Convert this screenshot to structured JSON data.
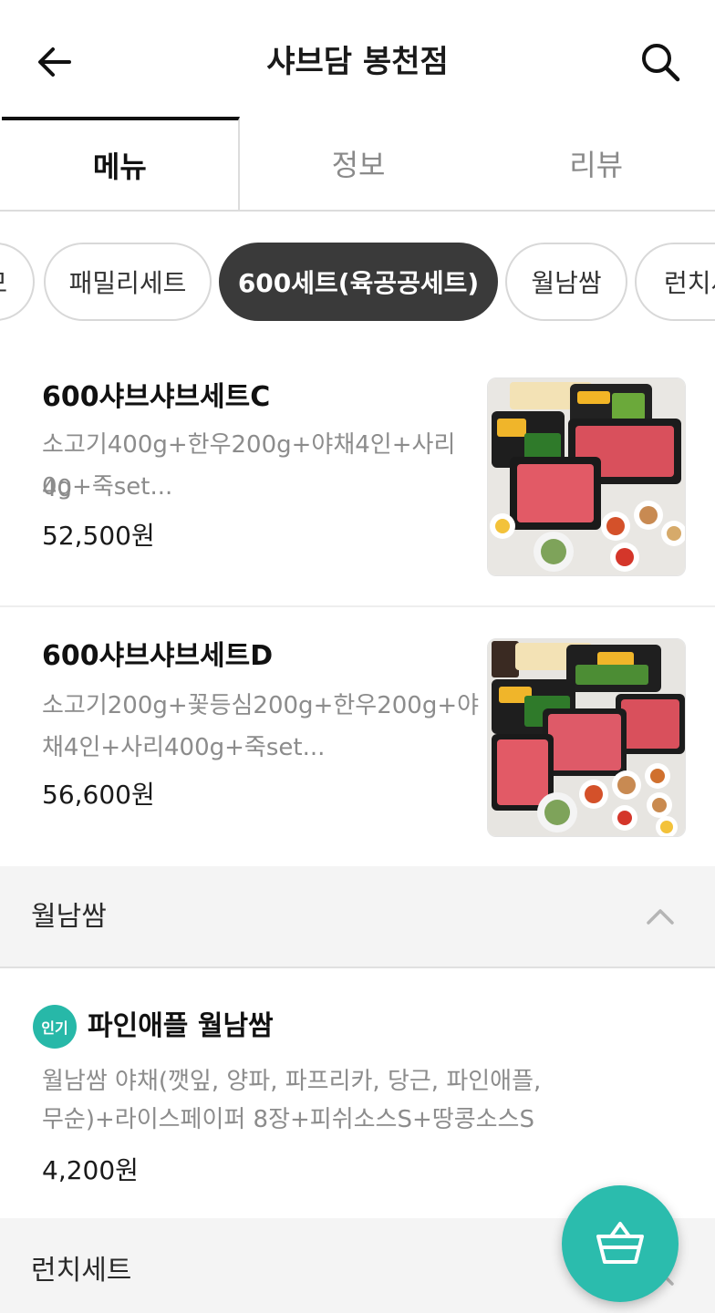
{
  "header": {
    "title": "샤브담 봉천점"
  },
  "tabs": [
    {
      "label": "메뉴"
    },
    {
      "label": "정보"
    },
    {
      "label": "리뷰"
    }
  ],
  "categories": [
    {
      "label": "모"
    },
    {
      "label": "패밀리세트"
    },
    {
      "label": "600세트(육공공세트)"
    },
    {
      "label": "월남쌈"
    },
    {
      "label": "런치세"
    }
  ],
  "active_category": "600세트(육공공세트)",
  "items": [
    {
      "name": "600샤브샤브세트C",
      "desc_line1": "소고기400g+한우200g+야채4인+사리40",
      "desc_line2": "0g+죽set...",
      "price": "52,500원"
    },
    {
      "name": "600샤브샤브세트D",
      "desc_line1": "소고기200g+꽃등심200g+한우200g+야",
      "desc_line2": "채4인+사리400g+죽set...",
      "price": "56,600원"
    }
  ],
  "section_wolnam": {
    "label": "월남쌈"
  },
  "wolnam_item": {
    "badge": "인기",
    "name": "파인애플 월남쌈",
    "desc_line1": "월남쌈 야채(깻잎, 양파, 파프리카, 당근, 파인애플,",
    "desc_line2": "무순)+라이스페이퍼 8장+피쉬소스S+땅콩소스S",
    "price": "4,200원"
  },
  "section_lunch": {
    "label": "런치세트"
  },
  "colors": {
    "accent": "#2bbcad",
    "chip_active": "#3a3a3a"
  }
}
